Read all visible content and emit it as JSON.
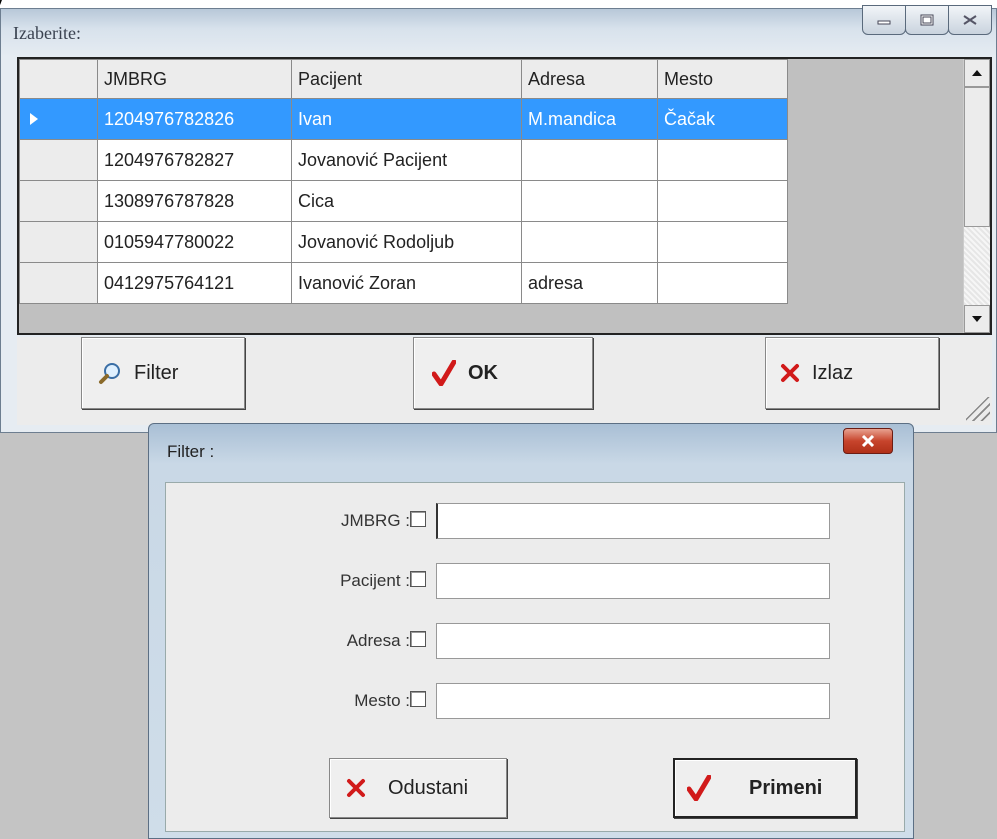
{
  "main_window": {
    "title": "Izaberite:",
    "columns": [
      "JMBRG",
      "Pacijent",
      "Adresa",
      "Mesto"
    ],
    "rows": [
      {
        "jmbrg": "1204976782826",
        "pacijent": "Ivan",
        "adresa": "M.mandica",
        "mesto": "Čačak",
        "selected": true
      },
      {
        "jmbrg": "1204976782827",
        "pacijent": "Jovanović Pacijent",
        "adresa": "",
        "mesto": ""
      },
      {
        "jmbrg": "1308976787828",
        "pacijent": "Cica",
        "adresa": "",
        "mesto": ""
      },
      {
        "jmbrg": "0105947780022",
        "pacijent": "Jovanović Rodoljub",
        "adresa": "",
        "mesto": ""
      },
      {
        "jmbrg": "0412975764121",
        "pacijent": "Ivanović Zoran",
        "adresa": "adresa",
        "mesto": ""
      }
    ],
    "buttons": {
      "filter": "Filter",
      "ok": "OK",
      "exit": "Izlaz"
    }
  },
  "filter_dialog": {
    "title": "Filter :",
    "fields": [
      {
        "label": "JMBRG :",
        "value": "",
        "checked": false
      },
      {
        "label": "Pacijent :",
        "value": "",
        "checked": false
      },
      {
        "label": "Adresa :",
        "value": "",
        "checked": false
      },
      {
        "label": "Mesto :",
        "value": "",
        "checked": false
      }
    ],
    "buttons": {
      "cancel": "Odustani",
      "apply": "Primeni"
    }
  },
  "colors": {
    "selection": "#3399ff",
    "check_red": "#d11a1a",
    "close_red": "#c7442c"
  },
  "icons": [
    "magnifier-icon",
    "checkmark-icon",
    "x-icon",
    "minimize-icon",
    "maximize-icon",
    "restore-icon",
    "close-icon"
  ]
}
